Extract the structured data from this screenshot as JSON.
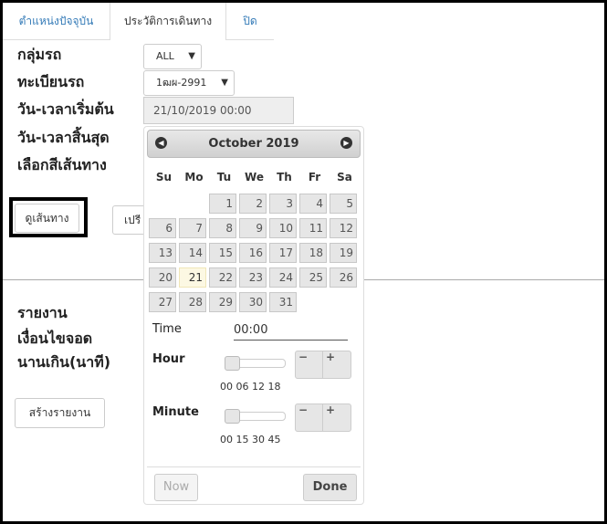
{
  "tabs": [
    {
      "label": "ตำแหน่งปัจจุบัน"
    },
    {
      "label": "ประวัติการเดินทาง"
    },
    {
      "label": "ปิด"
    }
  ],
  "form": {
    "group_label": "กลุ่มรถ",
    "group_value": "ALL",
    "plate_label": "ทะเบียนรถ",
    "plate_value": "1ฒผ-2991",
    "start_label": "วัน-เวลาเริ่มต้น",
    "start_value": "21/10/2019 00:00",
    "end_label": "วัน-เวลาสิ้นสุด",
    "color_label": "เลือกสีเส้นทาง",
    "view_route_button": "ดูเส้นทาง",
    "compare_button": "เปรี"
  },
  "report": {
    "title": "รายงาน",
    "cond1": "เงื่อนไขจอด",
    "cond2": "นานเกิน(นาที)",
    "create_button": "สร้างรายงาน"
  },
  "datepicker": {
    "month_title": "October 2019",
    "weekdays": [
      "Su",
      "Mo",
      "Tu",
      "We",
      "Th",
      "Fr",
      "Sa"
    ],
    "days": [
      "1",
      "2",
      "3",
      "4",
      "5",
      "6",
      "7",
      "8",
      "9",
      "10",
      "11",
      "12",
      "13",
      "14",
      "15",
      "16",
      "17",
      "18",
      "19",
      "20",
      "21",
      "22",
      "23",
      "24",
      "25",
      "26",
      "27",
      "28",
      "29",
      "30",
      "31"
    ],
    "selected_day": "21",
    "time_label": "Time",
    "time_value": "00:00",
    "hour_label": "Hour",
    "hour_ticks": "00 06 12 18",
    "hour_value": 0,
    "minute_label": "Minute",
    "minute_ticks": "00 15 30 45",
    "minute_value": 0,
    "minus": "−",
    "plus": "+",
    "now_button": "Now",
    "done_button": "Done"
  }
}
